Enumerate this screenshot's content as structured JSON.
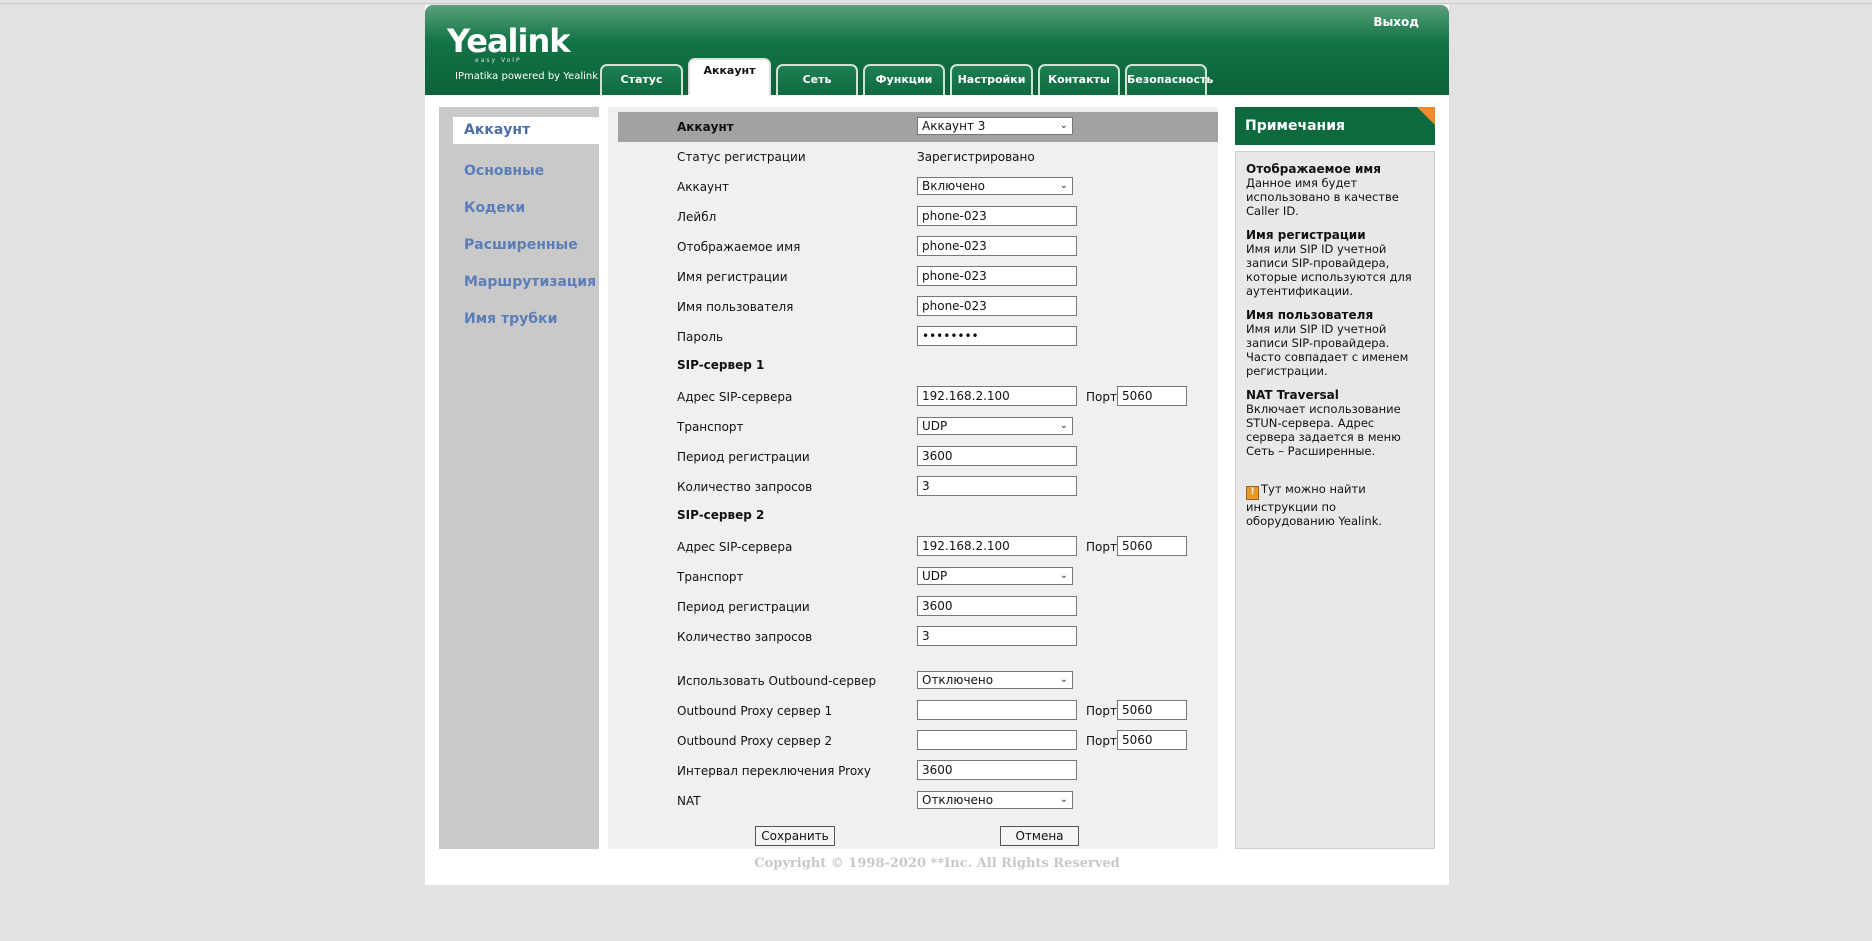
{
  "header": {
    "logo_text": "Yealink",
    "logo_sub": "easy VoIP",
    "logo_tagline": "IPmatika powered by Yealink",
    "exit_label": "Выход"
  },
  "tabs": [
    {
      "label": "Статус",
      "active": false
    },
    {
      "label": "Аккаунт",
      "active": true
    },
    {
      "label": "Сеть",
      "active": false
    },
    {
      "label": "Функции",
      "active": false
    },
    {
      "label": "Настройки",
      "active": false
    },
    {
      "label": "Контакты",
      "active": false
    },
    {
      "label": "Безопасность",
      "active": false
    }
  ],
  "sidebar": {
    "items": [
      {
        "label": "Аккаунт",
        "active": true
      },
      {
        "label": "Основные"
      },
      {
        "label": "Кодеки"
      },
      {
        "label": "Расширенные"
      },
      {
        "label": "Маршрутизация"
      },
      {
        "label": "Имя трубки"
      }
    ]
  },
  "form": {
    "account_label": "Аккаунт",
    "account_select": "Аккаунт 3",
    "reg_status_label": "Статус регистрации",
    "reg_status_value": "Зарегистрировано",
    "line_active_label": "Аккаунт",
    "line_active_value": "Включено",
    "label_label": "Лейбл",
    "label_value": "phone-023",
    "display_name_label": "Отображаемое имя",
    "display_name_value": "phone-023",
    "reg_name_label": "Имя регистрации",
    "reg_name_value": "phone-023",
    "user_name_label": "Имя пользователя",
    "user_name_value": "phone-023",
    "password_label": "Пароль",
    "password_value": "••••••••",
    "sip1_title": "SIP-сервер 1",
    "sip1_addr_label": "Адрес SIP-сервера",
    "sip1_addr_value": "192.168.2.100",
    "sip1_port_label": "Порт",
    "sip1_port_value": "5060",
    "sip1_transport_label": "Транспорт",
    "sip1_transport_value": "UDP",
    "sip1_period_label": "Период регистрации",
    "sip1_period_value": "3600",
    "sip1_retries_label": "Количество запросов",
    "sip1_retries_value": "3",
    "sip2_title": "SIP-сервер 2",
    "sip2_addr_label": "Адрес SIP-сервера",
    "sip2_addr_value": "192.168.2.100",
    "sip2_port_label": "Порт",
    "sip2_port_value": "5060",
    "sip2_transport_label": "Транспорт",
    "sip2_transport_value": "UDP",
    "sip2_period_label": "Период регистрации",
    "sip2_period_value": "3600",
    "sip2_retries_label": "Количество запросов",
    "sip2_retries_value": "3",
    "outbound_use_label": "Использовать Outbound-сервер",
    "outbound_use_value": "Отключено",
    "proxy1_label": "Outbound Proxy сервер 1",
    "proxy1_value": "",
    "proxy1_port_label": "Порт",
    "proxy1_port_value": "5060",
    "proxy2_label": "Outbound Proxy сервер 2",
    "proxy2_value": "",
    "proxy2_port_label": "Порт",
    "proxy2_port_value": "5060",
    "proxy_interval_label": "Интервал переключения Proxy",
    "proxy_interval_value": "3600",
    "nat_label": "NAT",
    "nat_value": "Отключено",
    "save_label": "Сохранить",
    "cancel_label": "Отмена"
  },
  "notes": {
    "title": "Примечания",
    "items": [
      {
        "title": "Отображаемое имя",
        "text": "Данное имя будет использовано в качестве Caller ID."
      },
      {
        "title": "Имя регистрации",
        "text": "Имя или SIP ID учетной записи SIP-провайдера, которые используются для аутентификации."
      },
      {
        "title": "Имя пользователя",
        "text": "Имя или SIP ID учетной записи SIP-провайдера. Часто совпадает с именем регистрации."
      },
      {
        "title": "NAT Traversal",
        "text": "Включает использование STUN-сервера. Адрес сервера задается в меню Сеть – Расширенные."
      }
    ],
    "help_text": "Тут можно найти инструкции по оборудованию Yealink."
  },
  "footer": {
    "copyright": "Copyright © 1998-2020 **Inc. All Rights Reserved"
  },
  "colors": {
    "header_green": "#0d6a3f",
    "sidebar_link": "#5b7eb8",
    "notes_corner": "#f08a2c"
  }
}
